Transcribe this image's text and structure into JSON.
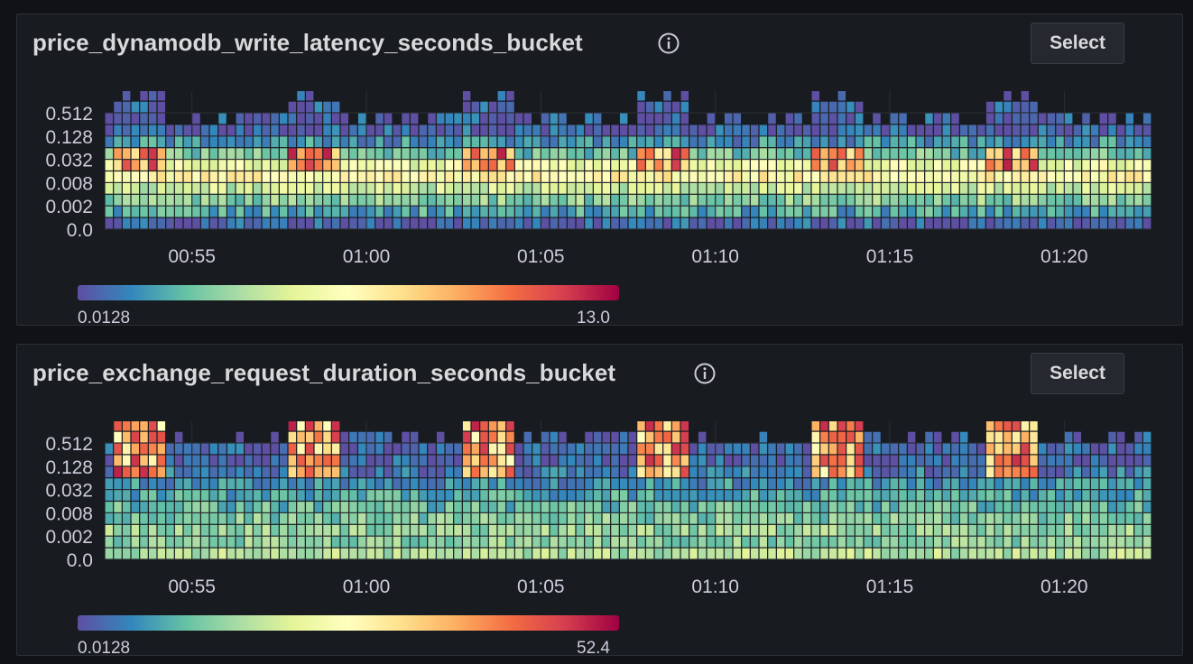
{
  "panels": [
    {
      "title": "price_dynamodb_write_latency_seconds_bucket",
      "select_label": "Select",
      "legend": {
        "min": "0.0128",
        "max": "13.0"
      }
    },
    {
      "title": "price_exchange_request_duration_seconds_bucket",
      "select_label": "Select",
      "legend": {
        "min": "0.0128",
        "max": "52.4"
      }
    }
  ],
  "colors": {
    "panel_bg": "#181b1f",
    "grid": "#2c2f35",
    "text": "#ccccdc",
    "scheme": [
      "#5e4fa2",
      "#3288bd",
      "#66c2a5",
      "#abdda4",
      "#e6f598",
      "#ffffbf",
      "#fee08b",
      "#fdae61",
      "#f46d43",
      "#d53e4f",
      "#9e0142"
    ]
  },
  "chart_data": [
    {
      "type": "heatmap",
      "title": "price_dynamodb_write_latency_seconds_bucket",
      "color_scheme": "Spectral",
      "color_range": [
        0.0128,
        13.0
      ],
      "y_tick_labels": [
        "0.0",
        "0.002",
        "0.008",
        "0.032",
        "0.128",
        "0.512"
      ],
      "x_tick_labels": [
        "00:55",
        "01:00",
        "01:05",
        "01:10",
        "01:15",
        "01:20"
      ],
      "x_range": [
        "00:52:30",
        "01:22:30"
      ],
      "bucket_count": 10,
      "spike_times": [
        "00:53:30",
        "00:58:30",
        "01:03:30",
        "01:08:30",
        "01:13:30",
        "01:18:30"
      ],
      "grid": true,
      "legend": "bottom-left"
    },
    {
      "type": "heatmap",
      "title": "price_exchange_request_duration_seconds_bucket",
      "color_scheme": "Spectral",
      "color_range": [
        0.0128,
        52.4
      ],
      "y_tick_labels": [
        "0.0",
        "0.002",
        "0.008",
        "0.032",
        "0.128",
        "0.512"
      ],
      "x_tick_labels": [
        "00:55",
        "01:00",
        "01:05",
        "01:10",
        "01:15",
        "01:20"
      ],
      "x_range": [
        "00:52:30",
        "01:22:30"
      ],
      "bucket_count": 11,
      "spike_times": [
        "00:53:30",
        "00:58:30",
        "01:03:30",
        "01:08:30",
        "01:13:30",
        "01:18:30"
      ],
      "grid": true,
      "legend": "bottom-left"
    }
  ]
}
